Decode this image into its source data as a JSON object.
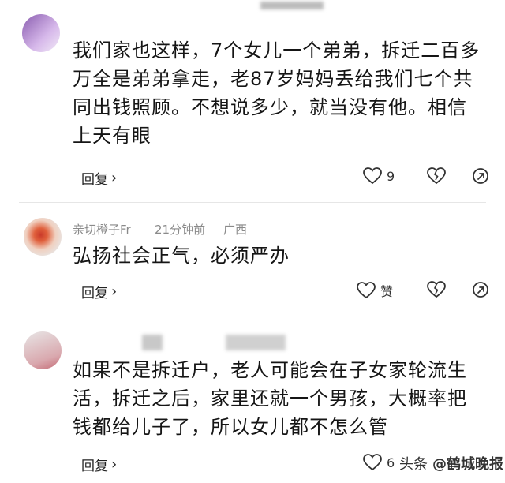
{
  "comments": [
    {
      "text_lines": [
        "我们家也这样，7个女儿一个弟弟，拆迁二百多",
        "万全是弟弟拿走，老87岁妈妈丢给我们七个共",
        "同出钱照顾。不想说多少，就当没有他。相信",
        "上天有眼"
      ],
      "reply_label": "回复",
      "like_count": "9"
    },
    {
      "author": "亲切橙子Fr",
      "time": "21分钟前",
      "location": "广西",
      "text_lines": [
        "弘扬社会正气，必须严办"
      ],
      "reply_label": "回复",
      "like_label": "赞"
    },
    {
      "text_lines": [
        "如果不是拆迁户，老人可能会在子女家轮流生",
        "活，拆迁之后，家里还就一个男孩，大概率把",
        "钱都给儿子了，所以女儿都不怎么管"
      ],
      "reply_label": "回复",
      "like_count": "6"
    }
  ],
  "watermark": {
    "prefix": "头条",
    "account": "@鹤城晚报"
  },
  "colors": {
    "text": "#151515",
    "meta": "#8a8a8a",
    "divider": "#e6e6e6"
  },
  "icons": [
    "heart-outline-icon",
    "broken-heart-icon",
    "share-icon",
    "chevron-right-icon"
  ]
}
